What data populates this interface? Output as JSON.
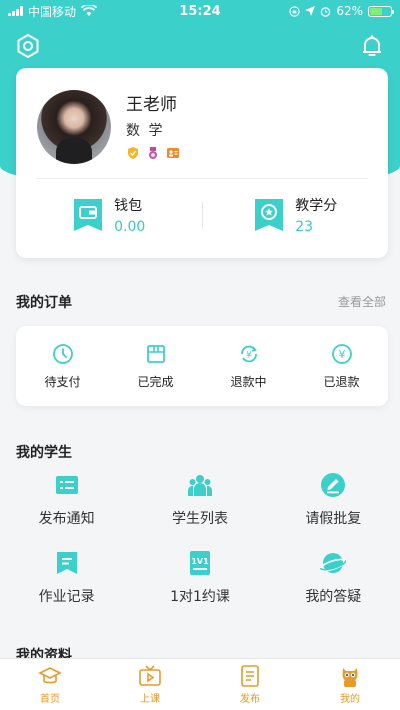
{
  "status_bar": {
    "carrier": "中国移动",
    "time": "15:24",
    "battery": "62%"
  },
  "profile": {
    "name": "王老师",
    "subject": "数 学"
  },
  "wallet": {
    "label": "钱包",
    "value": "0.00"
  },
  "teaching_points": {
    "label": "教学分",
    "value": "23"
  },
  "orders": {
    "title": "我的订单",
    "view_all": "查看全部",
    "items": [
      {
        "label": "待支付",
        "icon": "clock-icon"
      },
      {
        "label": "已完成",
        "icon": "box-icon"
      },
      {
        "label": "退款中",
        "icon": "refund-cycle-icon"
      },
      {
        "label": "已退款",
        "icon": "refunded-icon"
      }
    ]
  },
  "students": {
    "title": "我的学生",
    "items": [
      {
        "label": "发布通知",
        "icon": "notice-icon"
      },
      {
        "label": "学生列表",
        "icon": "students-icon"
      },
      {
        "label": "请假批复",
        "icon": "leave-approve-icon"
      },
      {
        "label": "作业记录",
        "icon": "homework-icon"
      },
      {
        "label": "1对1约课",
        "icon": "one-on-one-icon"
      },
      {
        "label": "我的答疑",
        "icon": "qa-icon"
      }
    ]
  },
  "materials": {
    "title": "我的资料"
  },
  "tabbar": {
    "items": [
      {
        "label": "首页",
        "icon": "home-icon"
      },
      {
        "label": "上课",
        "icon": "class-icon"
      },
      {
        "label": "发布",
        "icon": "publish-icon"
      },
      {
        "label": "我的",
        "icon": "profile-icon"
      }
    ]
  },
  "colors": {
    "accent": "#3cd0ca",
    "tab_active": "#e89a2a",
    "background": "#f4f5f7"
  }
}
